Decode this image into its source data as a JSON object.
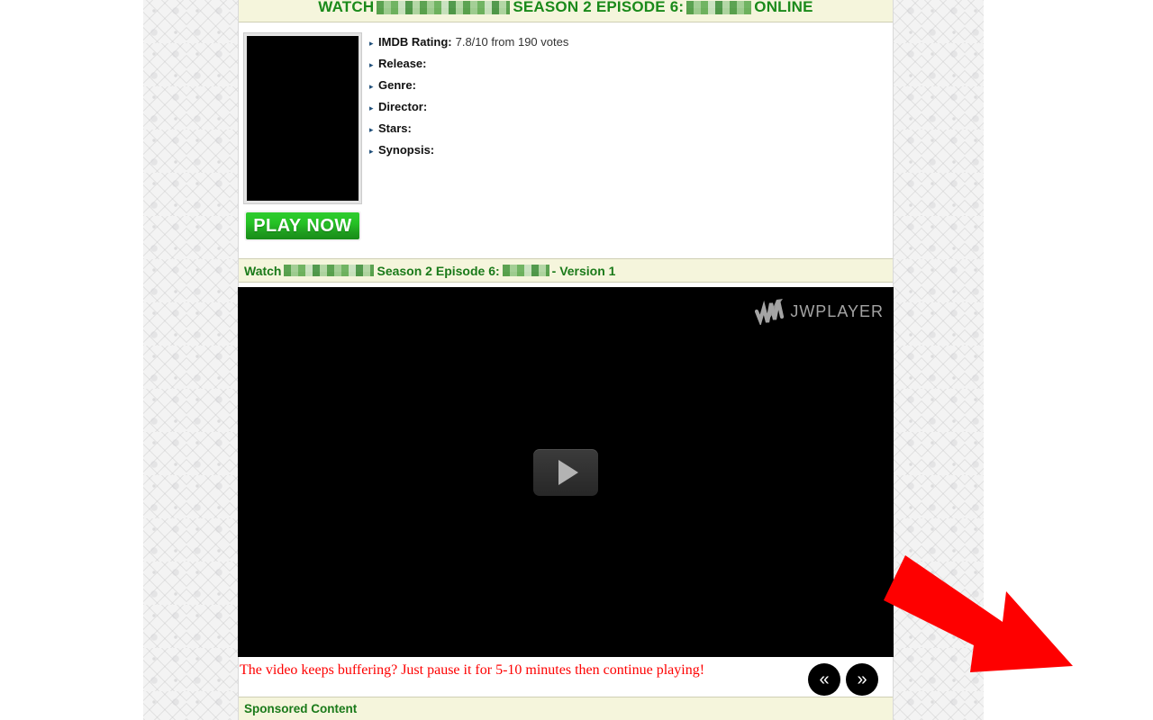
{
  "page": {
    "background_pattern": "light-gray-damask",
    "content_background": "#ffffff"
  },
  "header": {
    "prefix": "WATCH",
    "middle": "SEASON 2 EPISODE 6:",
    "suffix": "ONLINE",
    "redacted_title": "[redacted]",
    "redacted_episode": "[redacted]",
    "accent_color": "#1a8a1a",
    "band_color": "#f5f5dc"
  },
  "info": {
    "poster_alt": "movie-poster-black",
    "rows": [
      {
        "label": "IMDB Rating:",
        "value": "7.8/10 from 190 votes"
      },
      {
        "label": "Release:",
        "value": ""
      },
      {
        "label": "Genre:",
        "value": ""
      },
      {
        "label": "Director:",
        "value": ""
      },
      {
        "label": "Stars:",
        "value": ""
      },
      {
        "label": "Synopsis:",
        "value": ""
      }
    ],
    "play_now_label": "PLAY NOW",
    "play_now_color": "#25c225"
  },
  "version_bar": {
    "prefix": "Watch",
    "middle": "Season 2 Episode 6:",
    "suffix": "- Version 1",
    "redacted_title": "[redacted]",
    "redacted_episode": "[redacted]"
  },
  "player": {
    "brand": "JWPLAYER",
    "brand_icon": "jwplayer-w-logo",
    "play_icon": "play-triangle-icon",
    "poster_color": "#000000",
    "arrow_icon": "red-arrow-down-right",
    "arrow_color": "#fe0000"
  },
  "notice": {
    "text": "The video keeps buffering? Just pause it for 5-10 minutes then continue playing!",
    "color": "#fe0000"
  },
  "nav": {
    "prev_label": "«",
    "next_label": "»",
    "prev_icon": "chevron-double-left-icon",
    "next_icon": "chevron-double-right-icon"
  },
  "sponsored": {
    "heading": "Sponsored Content"
  }
}
